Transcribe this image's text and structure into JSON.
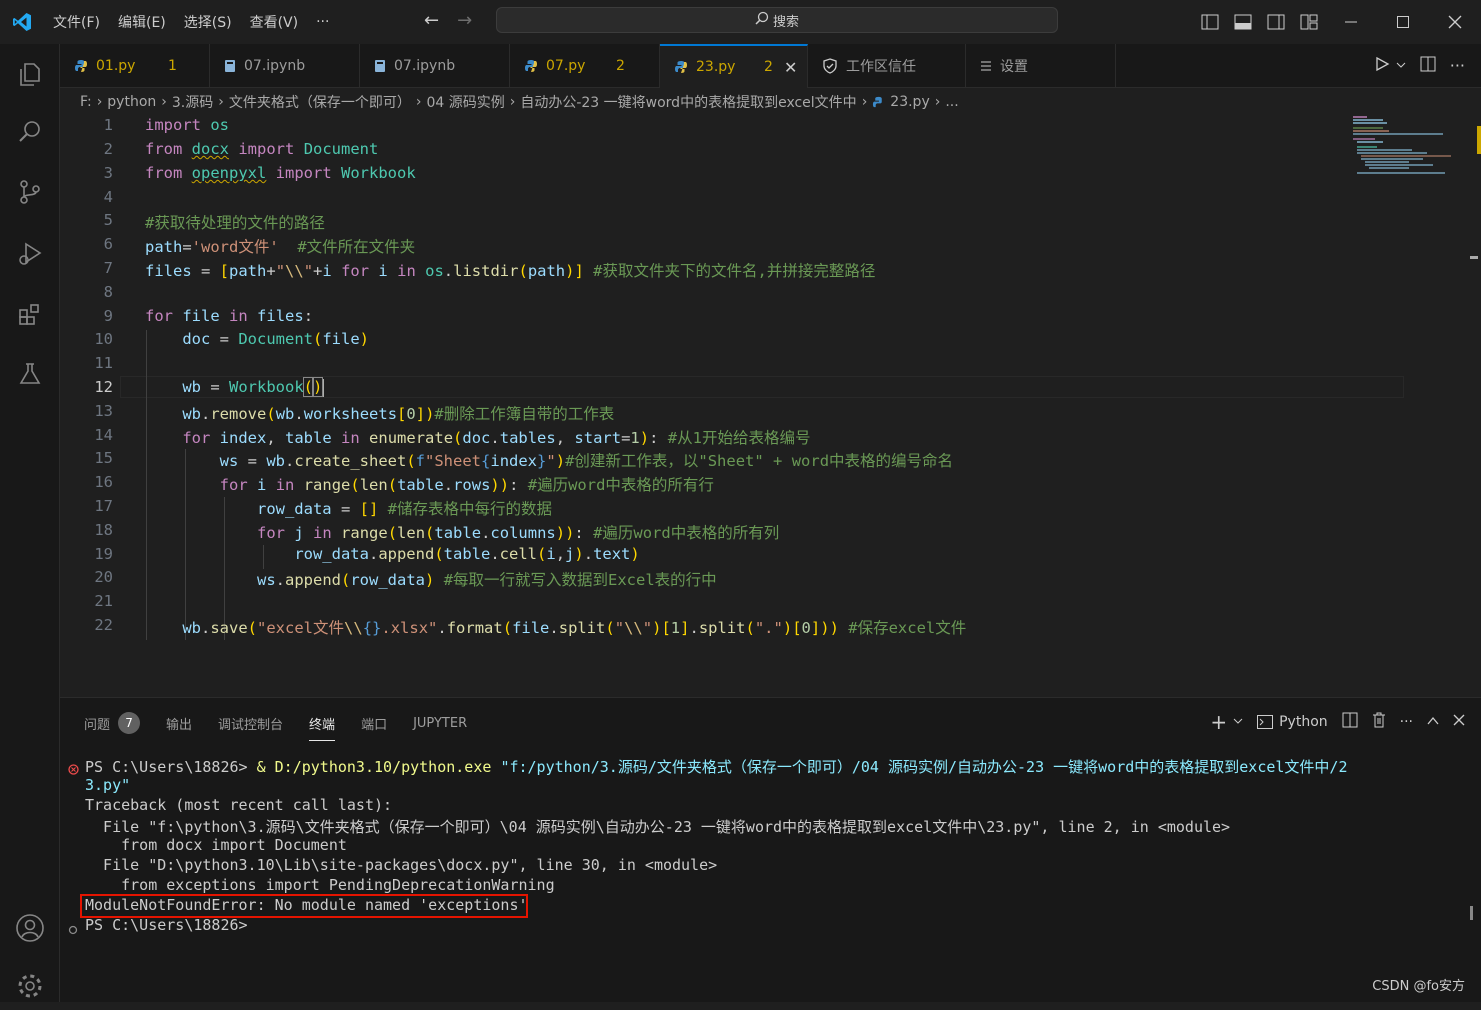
{
  "titlebar": {
    "menus": [
      "文件(F)",
      "编辑(E)",
      "选择(S)",
      "查看(V)",
      "···"
    ],
    "search": "搜索"
  },
  "tabs": [
    {
      "name": "01.py",
      "badge": "1",
      "kind": "py"
    },
    {
      "name": "07.ipynb",
      "badge": "",
      "kind": "nb"
    },
    {
      "name": "07.ipynb",
      "badge": "",
      "kind": "nb"
    },
    {
      "name": "07.py",
      "badge": "2",
      "kind": "py"
    },
    {
      "name": "23.py",
      "badge": "2",
      "kind": "py",
      "active": true
    },
    {
      "name": "工作区信任",
      "badge": "",
      "kind": "shield"
    },
    {
      "name": "设置",
      "badge": "",
      "kind": "settings"
    }
  ],
  "breadcrumb": [
    "F:",
    "python",
    "3.源码",
    "文件夹格式（保存一个即可）",
    "04 源码实例",
    "自动办公-23 一键将word中的表格提取到excel文件中",
    "23.py",
    "..."
  ],
  "editor": {
    "line_numbers": [
      "1",
      "2",
      "3",
      "4",
      "5",
      "6",
      "7",
      "8",
      "9",
      "10",
      "11",
      "12",
      "13",
      "14",
      "15",
      "16",
      "17",
      "18",
      "19",
      "20",
      "21",
      "22"
    ],
    "current_line": "12",
    "lines": [
      "import os",
      "from docx import Document",
      "from openpyxl import Workbook",
      "",
      "#获取待处理的文件的路径",
      "path='word文件'  #文件所在文件夹",
      "files = [path+\"\\\\\"+i for i in os.listdir(path)] #获取文件夹下的文件名,并拼接完整路径",
      "",
      "for file in files:",
      "    doc = Document(file)",
      "",
      "    wb = Workbook()",
      "    wb.remove(wb.worksheets[0])#删除工作簿自带的工作表",
      "    for index, table in enumerate(doc.tables, start=1): #从1开始给表格编号",
      "        ws = wb.create_sheet(f\"Sheet{index}\")#创建新工作表，以\"Sheet\" + word中表格的编号命名",
      "        for i in range(len(table.rows)): #遍历word中表格的所有行",
      "            row_data = [] #储存表格中每行的数据",
      "            for j in range(len(table.columns)): #遍历word中表格的所有列",
      "                row_data.append(table.cell(i,j).text)",
      "            ws.append(row_data) #每取一行就写入数据到Excel表的行中",
      "",
      "    wb.save(\"excel文件\\\\{}.xlsx\".format(file.split(\"\\\\\")[1].split(\".\")[0])) #保存excel文件"
    ]
  },
  "panel": {
    "tabs": [
      "问题",
      "输出",
      "调试控制台",
      "终端",
      "端口",
      "JUPYTER"
    ],
    "problems_count": "7",
    "active_tab": "终端",
    "shell_label": "Python",
    "terminal": [
      "PS C:\\Users\\18826> & D:/python3.10/python.exe \"f:/python/3.源码/文件夹格式（保存一个即可）/04 源码实例/自动办公-23 一键将word中的表格提取到excel文件中/2",
      "3.py\"",
      "Traceback (most recent call last):",
      "  File \"f:\\python\\3.源码\\文件夹格式（保存一个即可）\\04 源码实例\\自动办公-23 一键将word中的表格提取到excel文件中\\23.py\", line 2, in <module>",
      "    from docx import Document",
      "  File \"D:\\python3.10\\Lib\\site-packages\\docx.py\", line 30, in <module>",
      "    from exceptions import PendingDeprecationWarning",
      "ModuleNotFoundError: No module named 'exceptions'",
      "PS C:\\Users\\18826>"
    ]
  },
  "watermark": "CSDN @fo安方"
}
